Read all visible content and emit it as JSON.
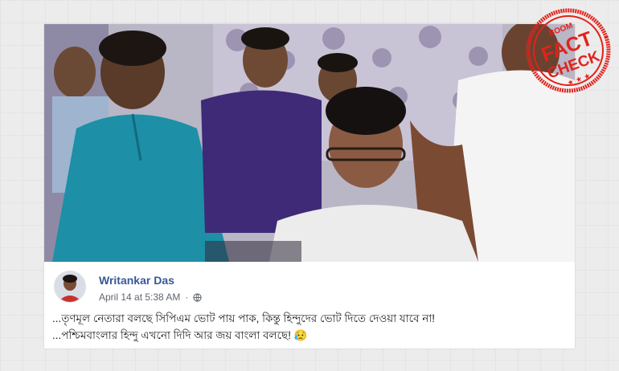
{
  "post": {
    "author": "Writankar Das",
    "date": "April 14 at 5:38 AM",
    "line1": "...তৃণমূল নেতারা বলছে সিপিএম ভোট পায় পাক, কিন্তু হিন্দুদের ভোট দিতে দেওয়া যাবে না!",
    "line2": "...পশ্চিমবাংলার হিন্দু এখনো দিদি আর জয় বাংলা বলছে! 😥"
  },
  "stamp": {
    "brand": "BOOM",
    "word1": "FACT",
    "word2": "CHECK",
    "color": "#e0231c"
  },
  "icons": {
    "privacy": "globe-icon"
  }
}
